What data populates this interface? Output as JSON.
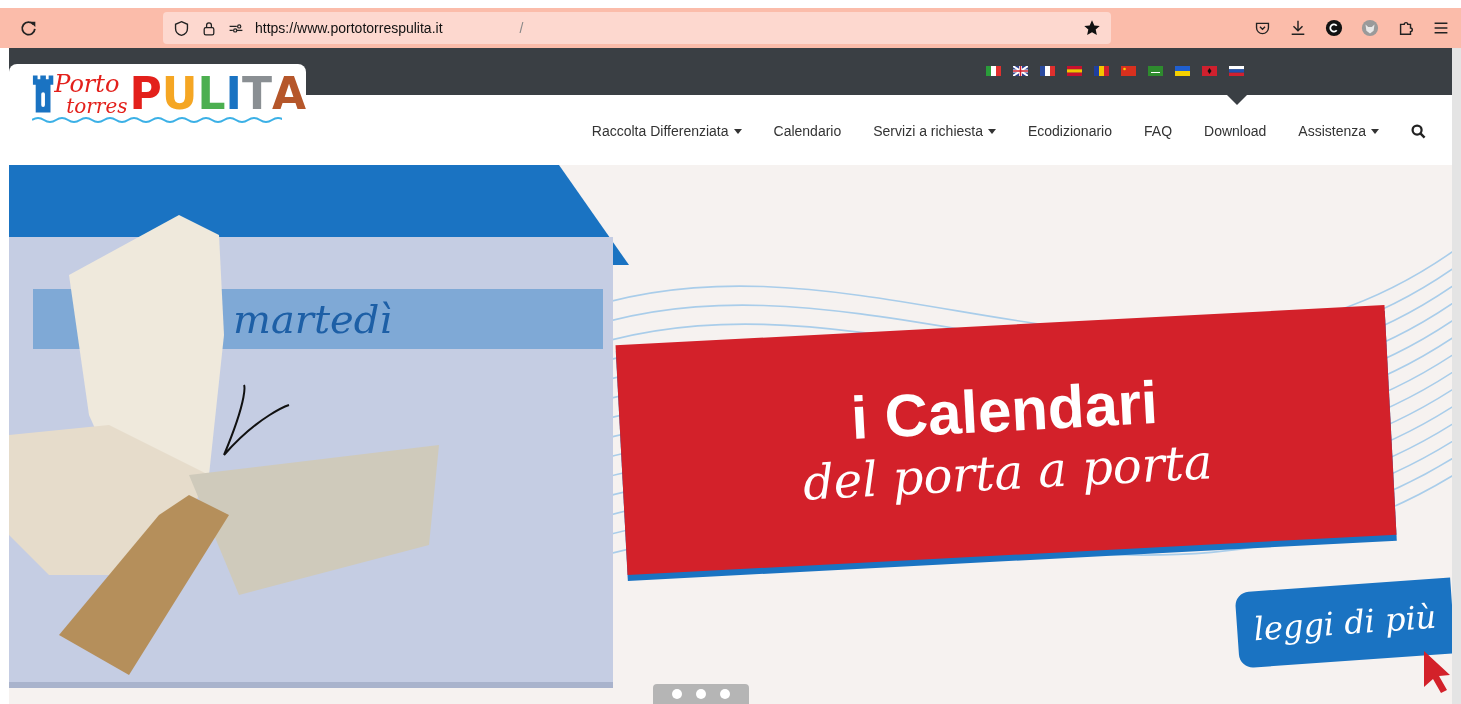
{
  "browser": {
    "url": "https://www.portotorrespulita.it",
    "url_suffix": "/"
  },
  "logo": {
    "script_top": "Porto",
    "script_bottom": "torres",
    "letters": [
      {
        "text": "P",
        "color": "#e3201b"
      },
      {
        "text": "U",
        "color": "#f5a623"
      },
      {
        "text": "L",
        "color": "#4caf50"
      },
      {
        "text": "I",
        "color": "#1a73c2"
      },
      {
        "text": "T",
        "color": "#8a8f93"
      },
      {
        "text": "A",
        "color": "#b5562a"
      }
    ]
  },
  "nav": [
    {
      "label": "Raccolta Differenziata",
      "dropdown": true
    },
    {
      "label": "Calendario",
      "dropdown": false
    },
    {
      "label": "Servizi a richiesta",
      "dropdown": true
    },
    {
      "label": "Ecodizionario",
      "dropdown": false
    },
    {
      "label": "FAQ",
      "dropdown": false
    },
    {
      "label": "Download",
      "dropdown": false
    },
    {
      "label": "Assistenza",
      "dropdown": true
    }
  ],
  "banner": {
    "day": "martedì",
    "headline": "i Calendari",
    "subline": "del porta a porta",
    "cta": "leggi di più"
  }
}
